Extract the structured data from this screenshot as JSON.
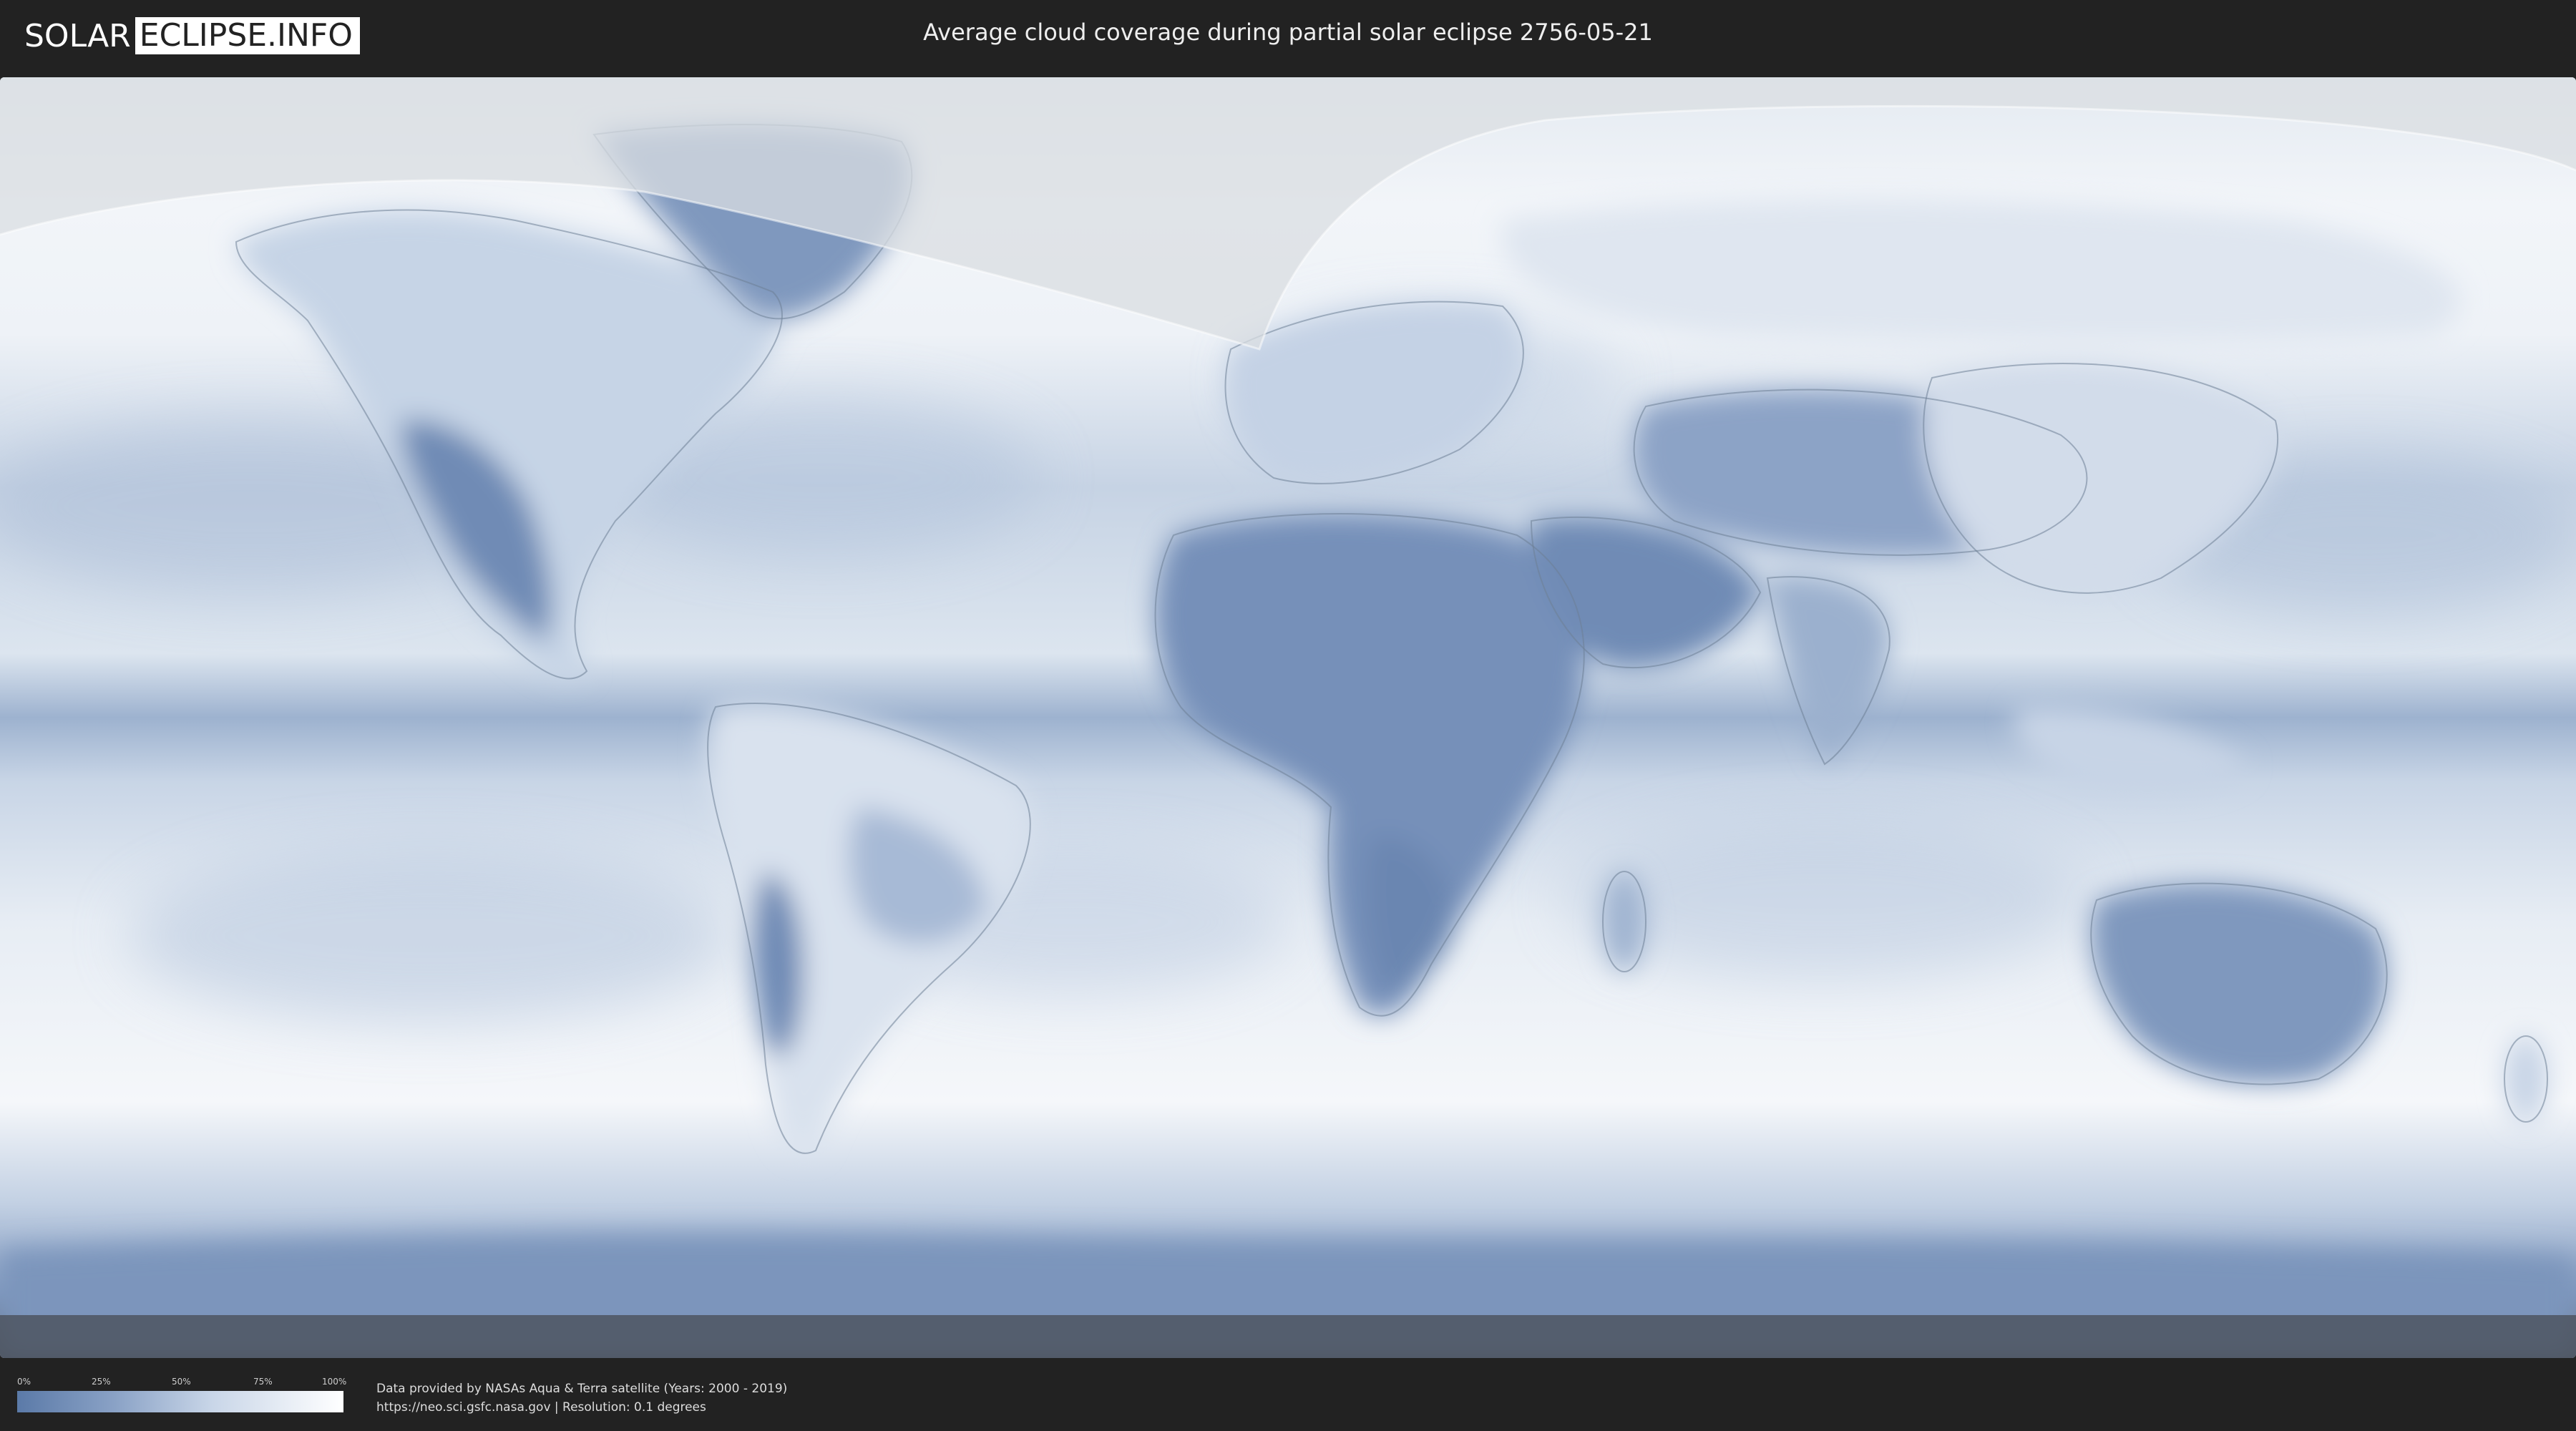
{
  "header": {
    "logo_left": "SOLAR",
    "logo_right": "ECLIPSE.INFO",
    "title": "Average cloud coverage during partial solar eclipse 2756-05-21"
  },
  "map": {
    "projection": "equirectangular",
    "colors": {
      "clear": "#5b7aa8",
      "cloudy": "#ffffff",
      "outline": "#6e7f96",
      "night_overlay": "#d9dde2"
    }
  },
  "legend": {
    "ticks": [
      "0%",
      "25%",
      "50%",
      "75%",
      "100%"
    ],
    "color_start": "#5b7aa8",
    "color_end": "#ffffff"
  },
  "credits": {
    "line1": "Data provided by NASAs Aqua & Terra satellite (Years: 2000 - 2019)",
    "line2": "https://neo.sci.gsfc.nasa.gov | Resolution: 0.1 degrees"
  }
}
